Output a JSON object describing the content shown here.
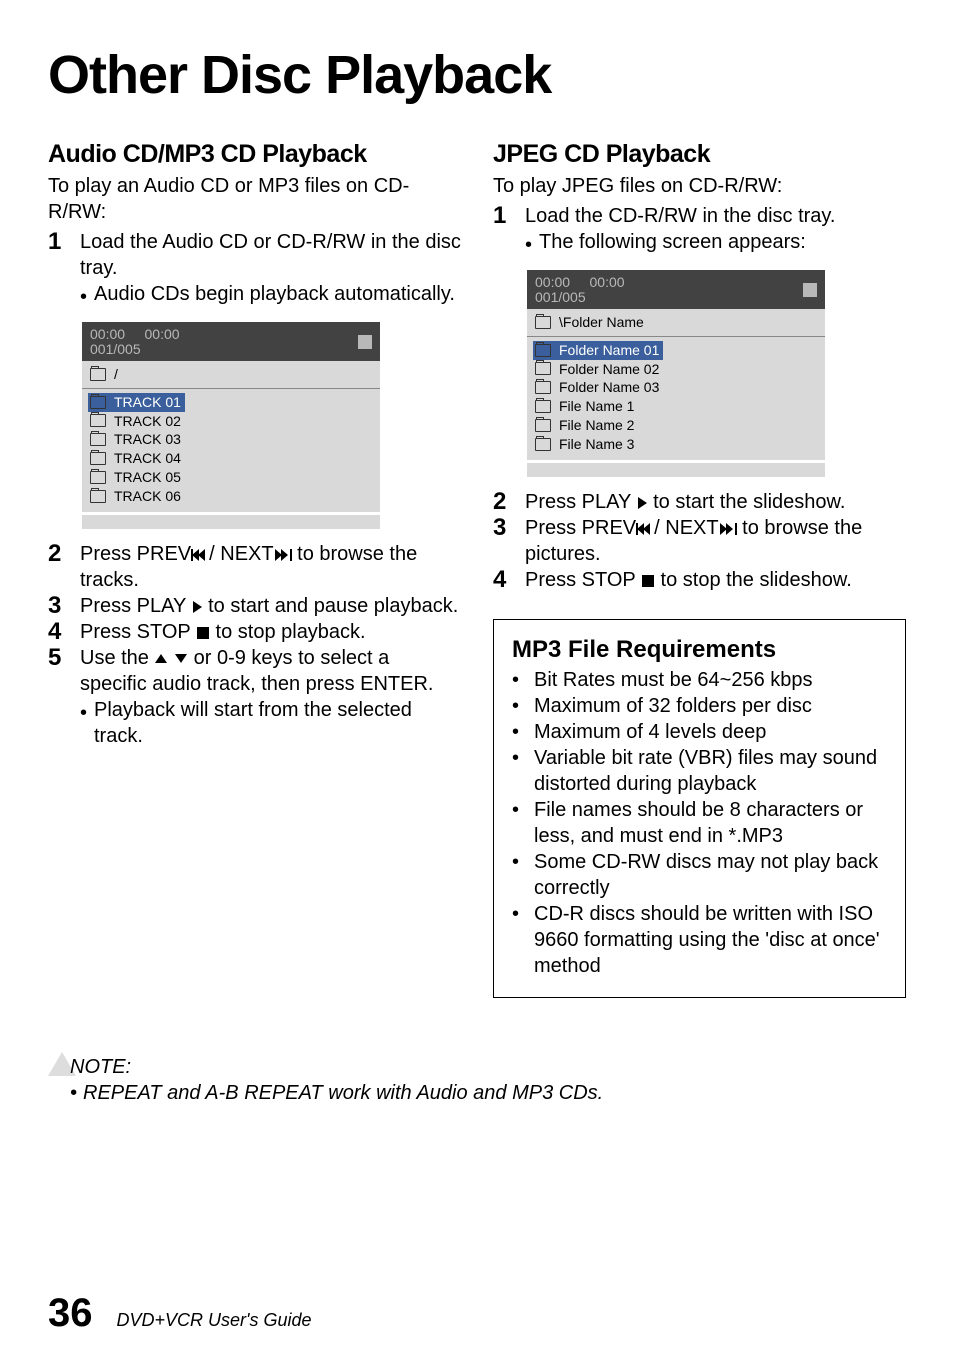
{
  "title": "Other Disc Playback",
  "left": {
    "heading": "Audio CD/MP3 CD Playback",
    "intro": "To play an Audio CD or MP3 files on CD-R/RW:",
    "steps": [
      {
        "text": "Load the Audio CD or CD-R/RW in the disc tray.",
        "sub": "Audio CDs begin playback automatically."
      },
      {
        "pre": "Press PREV",
        "mid": "/ NEXT",
        "post": " to browse the tracks."
      },
      {
        "pre": "Press PLAY ",
        "post": " to start and pause playback."
      },
      {
        "pre": "Press STOP ",
        "post": "  to stop playback."
      },
      {
        "pre": "Use the ",
        "post": " or 0-9 keys to select a specific audio track, then press ENTER.",
        "sub": "Playback will start from the selected track."
      }
    ],
    "shot": {
      "time1": "00:00",
      "time2": "00:00",
      "counter": "001/005",
      "path": "/",
      "items": [
        "TRACK 01",
        "TRACK 02",
        "TRACK 03",
        "TRACK 04",
        "TRACK 05",
        "TRACK 06"
      ]
    }
  },
  "right": {
    "heading": "JPEG CD Playback",
    "intro": "To play JPEG files on CD-R/RW:",
    "steps": [
      {
        "text": "Load the CD-R/RW in the disc tray.",
        "sub": "The following screen appears:"
      },
      {
        "pre": "Press PLAY ",
        "post": " to start the slideshow."
      },
      {
        "pre": "Press PREV",
        "mid": "/ NEXT",
        "post": " to browse the pictures."
      },
      {
        "pre": "Press STOP ",
        "post": "  to stop the slideshow."
      }
    ],
    "shot": {
      "time1": "00:00",
      "time2": "00:00",
      "counter": "001/005",
      "path": "\\Folder Name",
      "items": [
        "Folder Name 01",
        "Folder Name 02",
        "Folder Name 03",
        "File Name 1",
        "File Name 2",
        "File Name 3"
      ]
    },
    "callout_heading": "MP3 File Requirements",
    "callout_items": [
      "Bit Rates must be 64~256 kbps",
      "Maximum of 32 folders per disc",
      "Maximum of 4 levels deep",
      "Variable bit rate (VBR) files may sound distorted during playback",
      "File names should be 8 characters or less, and must end in *.MP3",
      "Some CD-RW discs may not play back correctly",
      "CD-R discs should be written with ISO 9660 formatting using the 'disc at once' method"
    ]
  },
  "note": {
    "label": "NOTE:",
    "text": "REPEAT and A-B REPEAT work with Audio and MP3 CDs."
  },
  "footer": {
    "page": "36",
    "guide": "DVD+VCR User's Guide"
  }
}
